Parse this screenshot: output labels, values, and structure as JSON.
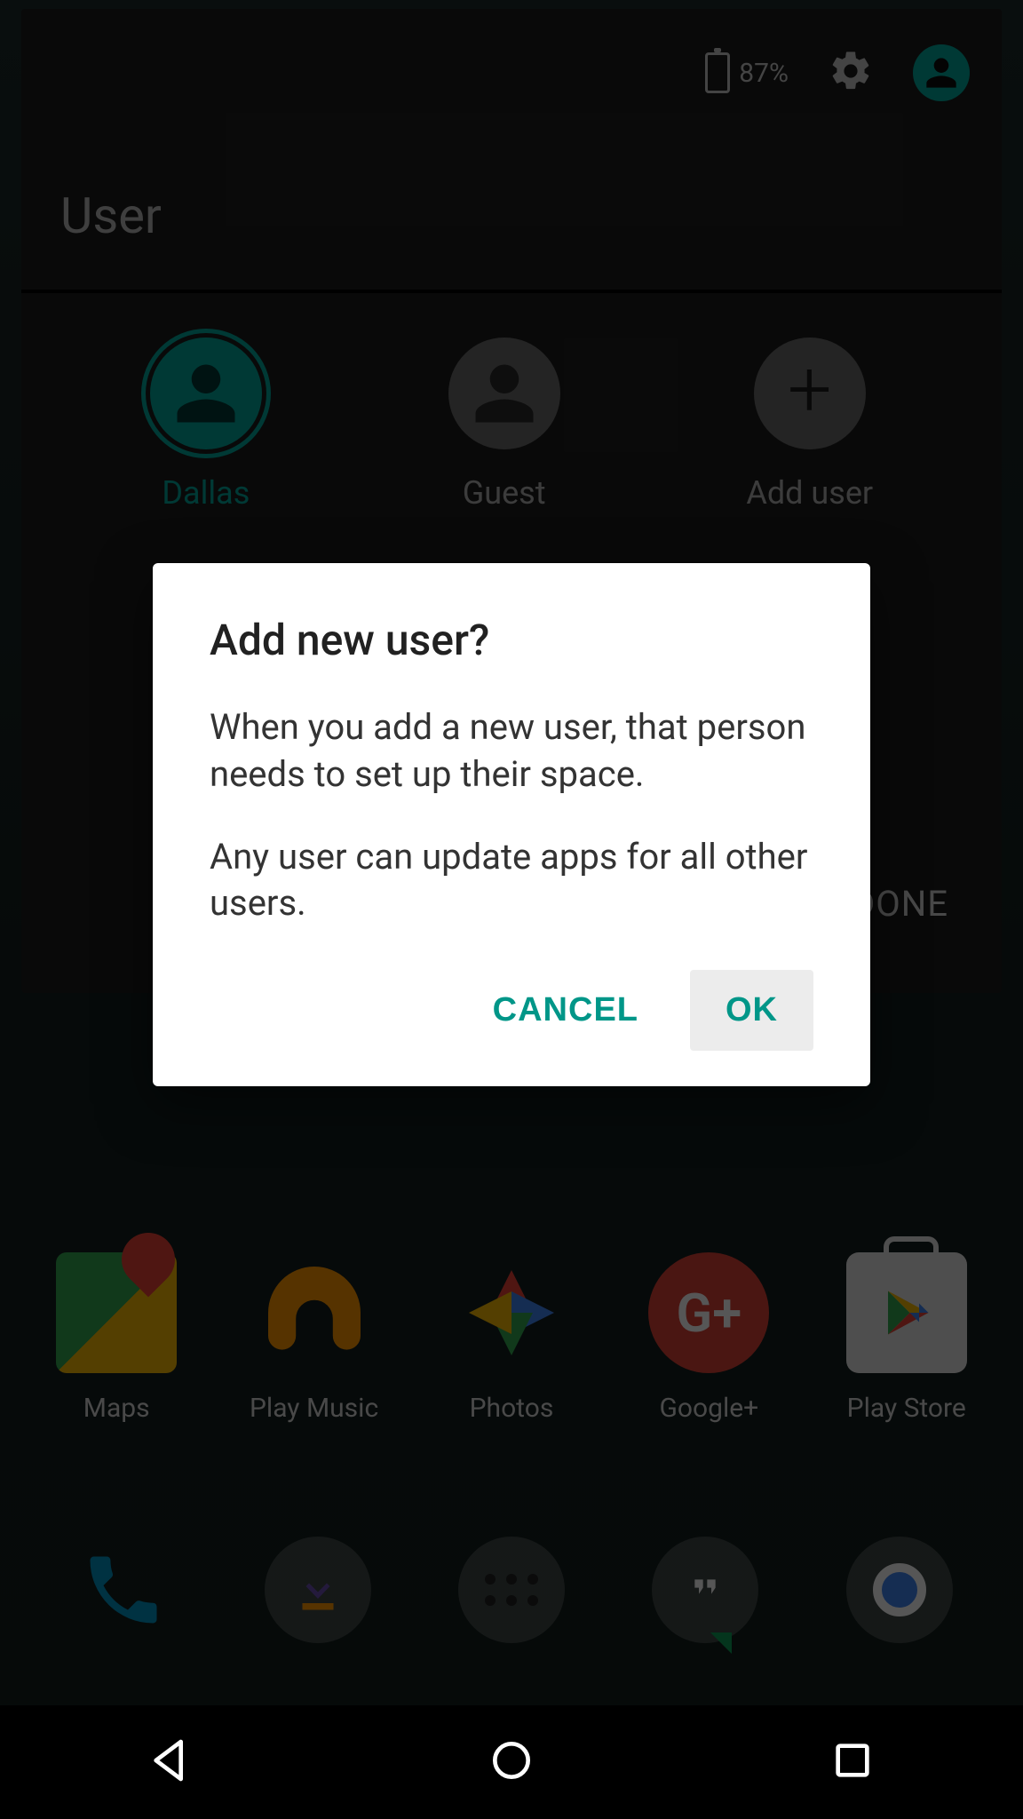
{
  "status": {
    "battery_percent": "87%"
  },
  "panel": {
    "title": "User",
    "done_label": "DONE",
    "users": [
      {
        "name": "Dallas"
      },
      {
        "name": "Guest"
      },
      {
        "name": "Add user"
      }
    ]
  },
  "dialog": {
    "title": "Add new user?",
    "body1": "When you add a new user, that person needs to set up their space.",
    "body2": "Any user can update apps for all other users.",
    "cancel": "CANCEL",
    "ok": "OK"
  },
  "apps": {
    "maps": "Maps",
    "music": "Play Music",
    "photos": "Photos",
    "gplus": "Google+",
    "pstore": "Play Store"
  },
  "colors": {
    "accent": "#009688"
  }
}
